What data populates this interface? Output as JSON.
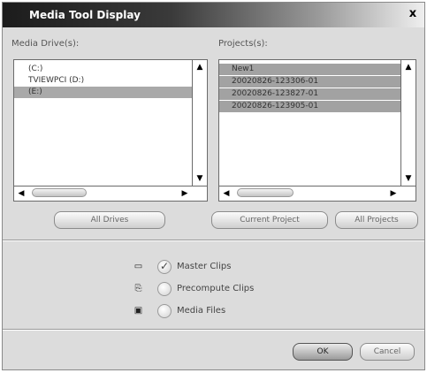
{
  "window": {
    "title": "Media Tool Display",
    "close_label": "x"
  },
  "media_drives": {
    "label": "Media Drive(s):",
    "items": [
      {
        "label": "(C:)",
        "selected": false
      },
      {
        "label": "TVIEWPCI (D:)",
        "selected": false
      },
      {
        "label": "(E:)",
        "selected": true
      }
    ]
  },
  "projects": {
    "label": "Projects(s):",
    "items": [
      {
        "label": "New1",
        "selected": true
      },
      {
        "label": "20020826-123306-01",
        "selected": true
      },
      {
        "label": "20020826-123827-01",
        "selected": true
      },
      {
        "label": "20020826-123905-01",
        "selected": true
      }
    ]
  },
  "buttons": {
    "all_drives": "All Drives",
    "current_project": "Current Project",
    "all_projects": "All Projects",
    "ok": "OK",
    "cancel": "Cancel"
  },
  "options": [
    {
      "label": "Master Clips",
      "icon": "master-clips-icon",
      "checked": true
    },
    {
      "label": "Precompute Clips",
      "icon": "precompute-clips-icon",
      "checked": false
    },
    {
      "label": "Media Files",
      "icon": "media-files-icon",
      "checked": false
    }
  ]
}
